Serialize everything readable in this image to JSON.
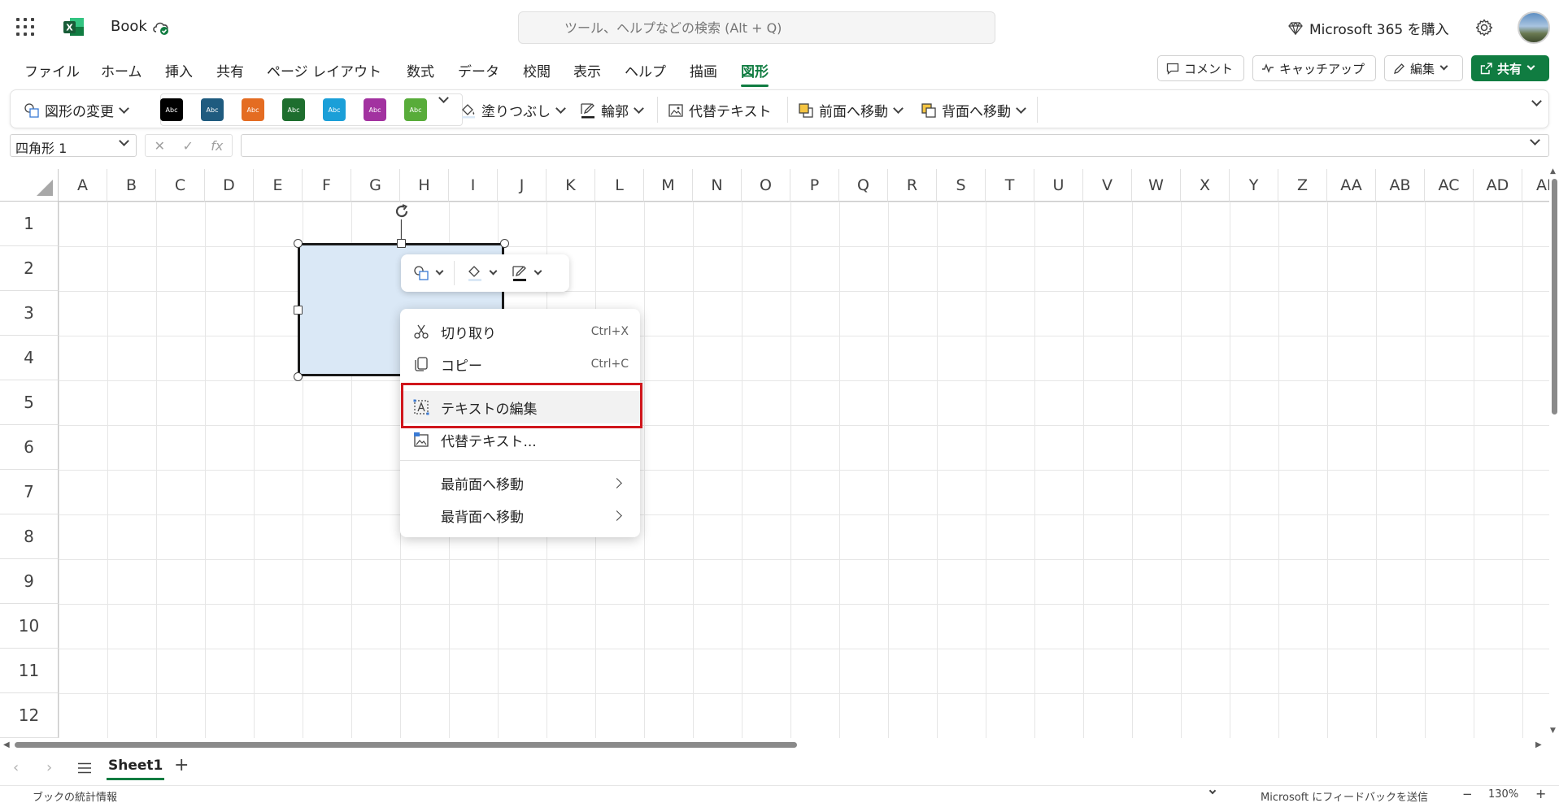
{
  "app": {
    "title": "Book"
  },
  "search": {
    "placeholder": "ツール、ヘルプなどの検索 (Alt + Q)"
  },
  "header": {
    "buy_label": "Microsoft 365 を購入"
  },
  "menu": {
    "tabs": [
      {
        "label": "ファイル"
      },
      {
        "label": "ホーム"
      },
      {
        "label": "挿入"
      },
      {
        "label": "共有"
      },
      {
        "label": "ページ レイアウト"
      },
      {
        "label": "数式"
      },
      {
        "label": "データ"
      },
      {
        "label": "校閲"
      },
      {
        "label": "表示"
      },
      {
        "label": "ヘルプ"
      },
      {
        "label": "描画"
      },
      {
        "label": "図形"
      }
    ],
    "active_tab": "図形",
    "comment_label": "コメント",
    "catchup_label": "キャッチアップ",
    "edit_label": "編集",
    "share_label": "共有"
  },
  "ribbon": {
    "change_shape_label": "図形の変更",
    "style_sample_text": "Abc",
    "style_colors": [
      "#000000",
      "#1f5b7f",
      "#e46c22",
      "#1e6e2e",
      "#1b9fd8",
      "#a232a0",
      "#58ac3a"
    ],
    "fill_label": "塗りつぶし",
    "outline_label": "輪郭",
    "alt_text_label": "代替テキスト",
    "bring_forward_label": "前面へ移動",
    "send_backward_label": "背面へ移動"
  },
  "formula_bar": {
    "name_box": "四角形 1",
    "fx_label": "fx",
    "formula": ""
  },
  "grid": {
    "columns": [
      "A",
      "B",
      "C",
      "D",
      "E",
      "F",
      "G",
      "H",
      "I",
      "J",
      "K",
      "L",
      "M",
      "N",
      "O",
      "P",
      "Q",
      "R",
      "S",
      "T",
      "U",
      "V",
      "W",
      "X",
      "Y",
      "Z",
      "AA",
      "AB",
      "AC",
      "AD",
      "AE"
    ],
    "rows": [
      "1",
      "2",
      "3",
      "4",
      "5",
      "6",
      "7",
      "8",
      "9",
      "10",
      "11",
      "12"
    ]
  },
  "shape": {
    "fill_color": "#dae8f6",
    "outline_color": "#1a1a1a"
  },
  "context_menu": {
    "cut": {
      "label": "切り取り",
      "shortcut": "Ctrl+X"
    },
    "copy": {
      "label": "コピー",
      "shortcut": "Ctrl+C"
    },
    "edit_text": {
      "label": "テキストの編集"
    },
    "alt_text": {
      "label": "代替テキスト..."
    },
    "bring_to_front": {
      "label": "最前面へ移動"
    },
    "send_to_back": {
      "label": "最背面へ移動"
    },
    "highlight_color": "#d0161c"
  },
  "sheets": {
    "tabs": [
      {
        "label": "Sheet1"
      }
    ]
  },
  "status": {
    "left": "ブックの統計情報",
    "feedback": "Microsoft にフィードバックを送信",
    "zoom": "130%",
    "zoom_minus": "−",
    "zoom_plus": "+"
  },
  "accent_color": "#107c41"
}
